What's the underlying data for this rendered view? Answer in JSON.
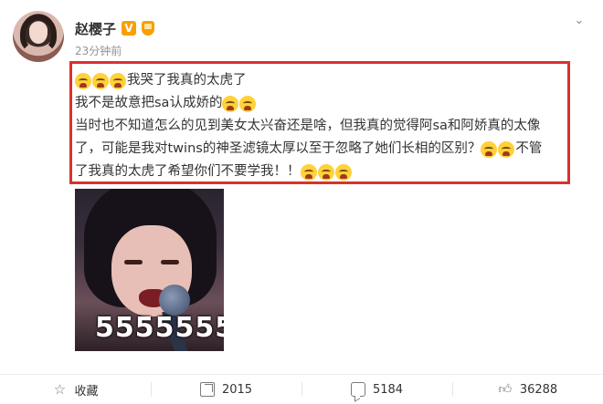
{
  "author": {
    "name": "赵樱子",
    "verified_badge": "V",
    "post_time": "23分钟前"
  },
  "post": {
    "lines": [
      {
        "emojis_before": 3,
        "text": "我哭了我真的太虎了",
        "emojis_after": 0
      },
      {
        "emojis_before": 0,
        "text": "我不是故意把sa认成娇的",
        "emojis_after": 2
      },
      {
        "emojis_before": 0,
        "text": "当时也不知道怎么的见到美女太兴奋还是啥，但我真的觉得阿sa和阿娇真的太像",
        "emojis_after": 0
      },
      {
        "emojis_before": 0,
        "text": "了，可能是我对twins的神圣滤镜太厚以至于忽略了她们长相的区别？",
        "emojis_after": 2,
        "text_after": "不管"
      },
      {
        "emojis_before": 0,
        "text": "了我真的太虎了希望你们不要学我！！",
        "emojis_after": 3
      }
    ],
    "emoji_name": "crying-emoji",
    "highlight_color": "#d9322d"
  },
  "media": {
    "caption": "5555555"
  },
  "actions": {
    "favorite_label": "收藏",
    "repost_count": "2015",
    "comment_count": "5184",
    "like_count": "36288"
  },
  "colors": {
    "badge": "#f7a000",
    "muted_text": "#939393"
  }
}
